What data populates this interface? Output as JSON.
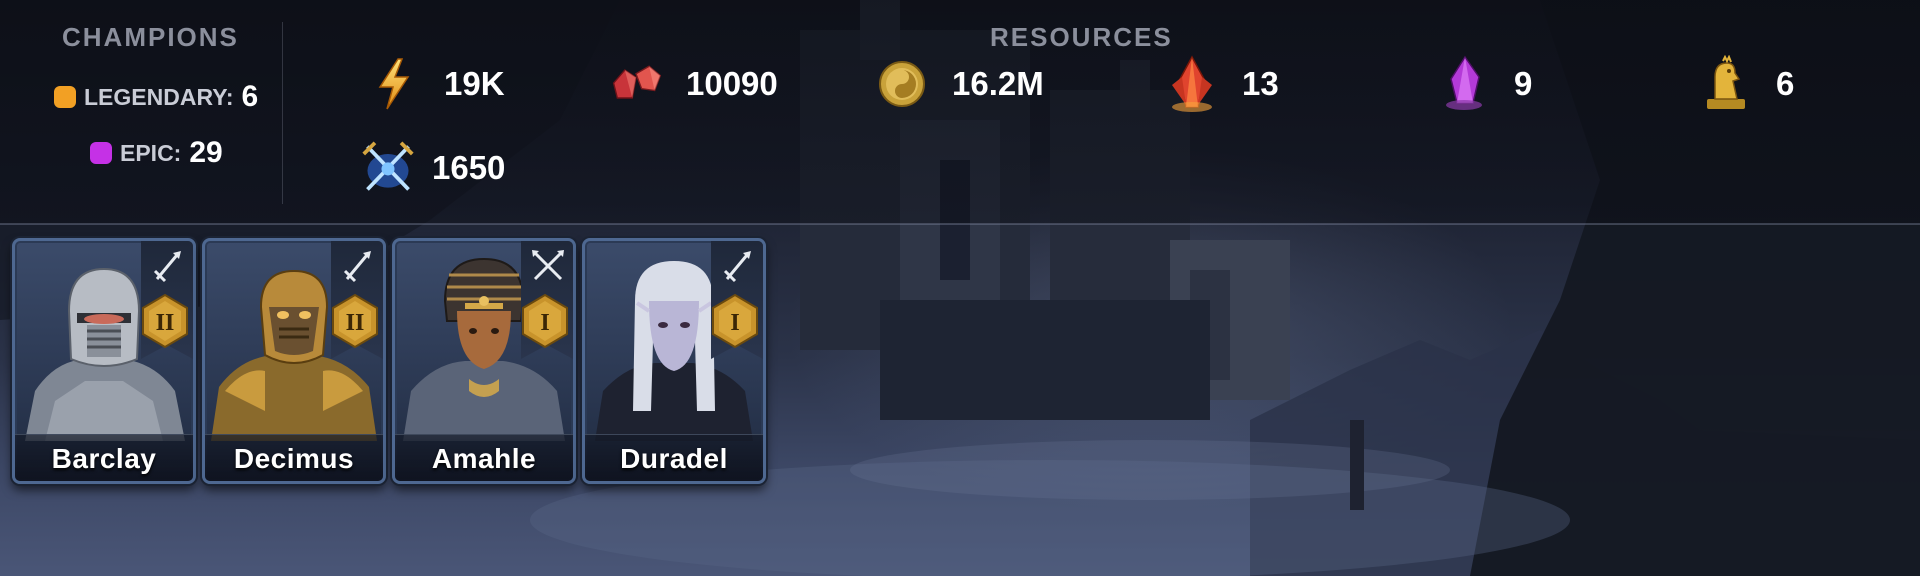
{
  "champions": {
    "heading": "CHAMPIONS",
    "rarities": [
      {
        "label": "LEGENDARY:",
        "count": "6",
        "color": "#f2a024"
      },
      {
        "label": "EPIC:",
        "count": "29",
        "color": "#c531e6"
      }
    ]
  },
  "resources": {
    "heading": "RESOURCES",
    "items": [
      {
        "icon": "energy-bolt-icon",
        "value": "19K"
      },
      {
        "icon": "rubies-icon",
        "value": "10090"
      },
      {
        "icon": "silver-coin-icon",
        "value": "16.2M"
      },
      {
        "icon": "red-shard-icon",
        "value": "13"
      },
      {
        "icon": "purple-shard-icon",
        "value": "9"
      },
      {
        "icon": "gold-chicken-icon",
        "value": "6"
      },
      {
        "icon": "arena-token-icon",
        "value": "1650"
      }
    ]
  },
  "champion_cards": [
    {
      "name": "Barclay",
      "rank": "II",
      "affinity": "sword-icon"
    },
    {
      "name": "Decimus",
      "rank": "II",
      "affinity": "sword-icon"
    },
    {
      "name": "Amahle",
      "rank": "I",
      "affinity": "crossed-arrows-icon"
    },
    {
      "name": "Duradel",
      "rank": "I",
      "affinity": "sword-icon"
    }
  ],
  "colors": {
    "legendary": "#f2a024",
    "epic": "#c531e6",
    "rank_badge": "#c8932b",
    "card_border": "#4e6891"
  }
}
